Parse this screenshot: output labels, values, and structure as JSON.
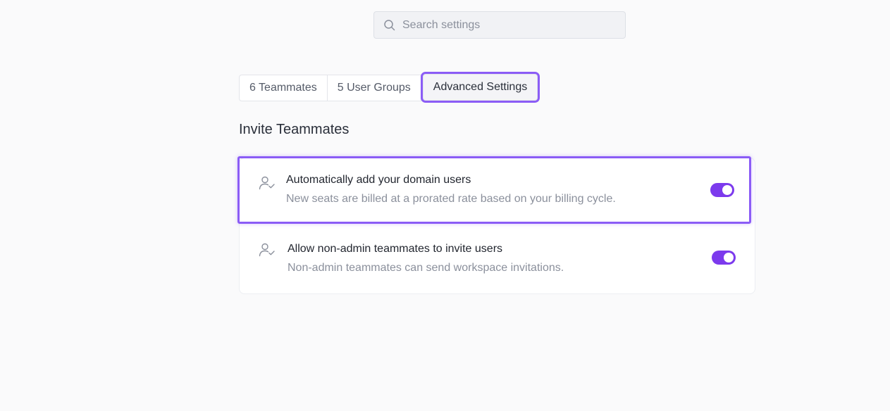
{
  "search": {
    "placeholder": "Search settings",
    "icon": "search-icon"
  },
  "tabs": [
    {
      "label": "6 Teammates",
      "active": false
    },
    {
      "label": "5 User Groups",
      "active": false
    },
    {
      "label": "Advanced Settings",
      "active": true
    }
  ],
  "section": {
    "title": "Invite Teammates"
  },
  "settings": [
    {
      "icon": "user-check-icon",
      "title": "Automatically add your domain users",
      "description": "New seats are billed at a prorated rate based on your billing cycle.",
      "enabled": true
    },
    {
      "icon": "user-check-icon",
      "title": "Allow non-admin teammates to invite users",
      "description": "Non-admin teammates can send workspace invitations.",
      "enabled": true
    }
  ],
  "colors": {
    "accent": "#7c3aed",
    "highlight": "#8b5cf6",
    "background": "#fafafb"
  }
}
